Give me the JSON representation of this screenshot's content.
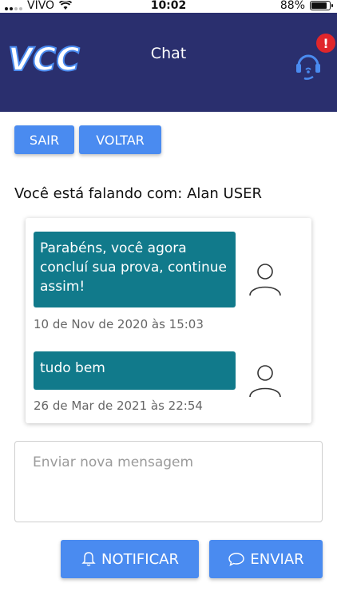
{
  "status_bar": {
    "carrier": "VIVO",
    "time": "10:02",
    "battery": "88%",
    "battery_level": 0.88
  },
  "header": {
    "logo_text": "VCC",
    "title": "Chat",
    "badge": "!"
  },
  "buttons": {
    "exit_label": "SAIR",
    "back_label": "VOLTAR",
    "notify_label": "NOTIFICAR",
    "send_label": "ENVIAR"
  },
  "talking_with": "Você está falando com: Alan USER",
  "messages": [
    {
      "text": "Parabéns, você agora concluí sua prova, continue assim!",
      "date": "10 de Nov de 2020 às 15:03"
    },
    {
      "text": "tudo bem",
      "date": "26 de Mar de 2021 às 22:54"
    }
  ],
  "composer": {
    "placeholder": "Enviar nova mensagem",
    "value": ""
  },
  "colors": {
    "header_bg": "#2a2f6e",
    "button_bg": "#4a8bf0",
    "bubble_bg": "#117a8b",
    "badge_bg": "#e0262b",
    "accent_icon": "#4a8bf0"
  },
  "icons": [
    "wifi-icon",
    "support-headset-icon",
    "alert-badge-icon",
    "user-avatar-icon",
    "bell-icon",
    "chat-bubble-icon"
  ]
}
